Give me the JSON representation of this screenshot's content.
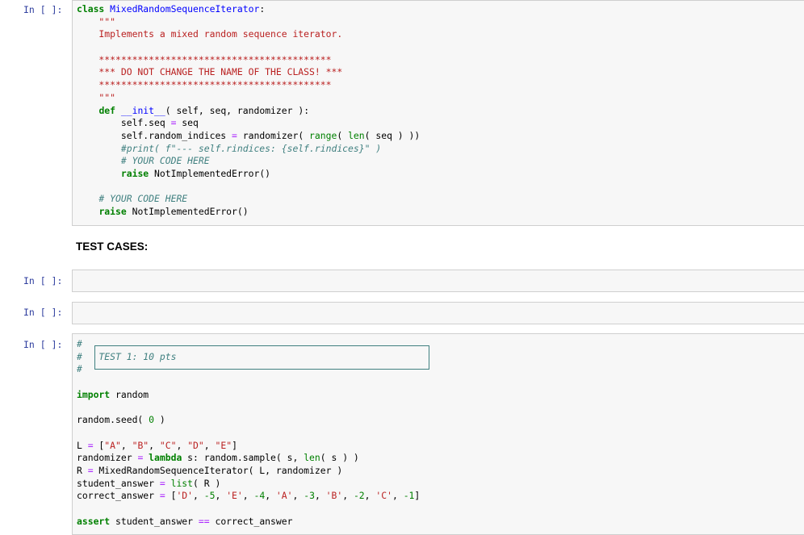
{
  "cells": {
    "cell1": {
      "prompt": "In [ ]:",
      "lines": [
        [
          {
            "t": "class ",
            "c": "kw"
          },
          {
            "t": "MixedRandomSequenceIterator",
            "c": "cls"
          },
          {
            "t": ":",
            "c": ""
          }
        ],
        [
          {
            "t": "    \"\"\"",
            "c": "str"
          }
        ],
        [
          {
            "t": "    Implements a mixed random sequence iterator.",
            "c": "str"
          }
        ],
        [
          {
            "t": "",
            "c": ""
          }
        ],
        [
          {
            "t": "    ******************************************",
            "c": "str"
          }
        ],
        [
          {
            "t": "    *** DO NOT CHANGE THE NAME OF THE CLASS! ***",
            "c": "str"
          }
        ],
        [
          {
            "t": "    ******************************************",
            "c": "str"
          }
        ],
        [
          {
            "t": "    \"\"\"",
            "c": "str"
          }
        ],
        [
          {
            "t": "    ",
            "c": ""
          },
          {
            "t": "def",
            "c": "kw"
          },
          {
            "t": " ",
            "c": ""
          },
          {
            "t": "__init__",
            "c": "cls"
          },
          {
            "t": "( self, seq, randomizer ):",
            "c": ""
          }
        ],
        [
          {
            "t": "        self",
            "c": ""
          },
          {
            "t": ".",
            "c": ""
          },
          {
            "t": "seq ",
            "c": ""
          },
          {
            "t": "=",
            "c": "op"
          },
          {
            "t": " seq",
            "c": ""
          }
        ],
        [
          {
            "t": "        self.random_indices ",
            "c": ""
          },
          {
            "t": "=",
            "c": "op"
          },
          {
            "t": " randomizer( ",
            "c": ""
          },
          {
            "t": "range",
            "c": "bi"
          },
          {
            "t": "( ",
            "c": ""
          },
          {
            "t": "len",
            "c": "bi"
          },
          {
            "t": "( seq ) ))",
            "c": ""
          }
        ],
        [
          {
            "t": "        #print( f\"--- self.rindices: {self.rindices}\" )",
            "c": "com"
          }
        ],
        [
          {
            "t": "        # YOUR CODE HERE",
            "c": "com"
          }
        ],
        [
          {
            "t": "        ",
            "c": ""
          },
          {
            "t": "raise",
            "c": "kw"
          },
          {
            "t": " NotImplementedError()",
            "c": ""
          }
        ],
        [
          {
            "t": "",
            "c": ""
          }
        ],
        [
          {
            "t": "    # YOUR CODE HERE",
            "c": "com"
          }
        ],
        [
          {
            "t": "    ",
            "c": ""
          },
          {
            "t": "raise",
            "c": "kw"
          },
          {
            "t": " NotImplementedError()",
            "c": ""
          }
        ]
      ]
    },
    "markdown": {
      "text": "TEST CASES:"
    },
    "cell2": {
      "prompt": "In [ ]:"
    },
    "cell3": {
      "prompt": "In [ ]:"
    },
    "cell4": {
      "prompt": "In [ ]:",
      "lines": [
        [
          {
            "t": "# ",
            "c": "com"
          }
        ],
        [
          {
            "t": "# ",
            "c": "com"
          },
          {
            "t": "  TEST 1: 10 pts",
            "c": "com"
          }
        ],
        [
          {
            "t": "# ",
            "c": "com"
          }
        ],
        [
          {
            "t": "",
            "c": ""
          }
        ],
        [
          {
            "t": "import",
            "c": "kw"
          },
          {
            "t": " random",
            "c": ""
          }
        ],
        [
          {
            "t": "",
            "c": ""
          }
        ],
        [
          {
            "t": "random.seed( ",
            "c": ""
          },
          {
            "t": "0",
            "c": "num"
          },
          {
            "t": " )",
            "c": ""
          }
        ],
        [
          {
            "t": "",
            "c": ""
          }
        ],
        [
          {
            "t": "L ",
            "c": ""
          },
          {
            "t": "=",
            "c": "op"
          },
          {
            "t": " [",
            "c": ""
          },
          {
            "t": "\"A\"",
            "c": "str"
          },
          {
            "t": ", ",
            "c": ""
          },
          {
            "t": "\"B\"",
            "c": "str"
          },
          {
            "t": ", ",
            "c": ""
          },
          {
            "t": "\"C\"",
            "c": "str"
          },
          {
            "t": ", ",
            "c": ""
          },
          {
            "t": "\"D\"",
            "c": "str"
          },
          {
            "t": ", ",
            "c": ""
          },
          {
            "t": "\"E\"",
            "c": "str"
          },
          {
            "t": "]",
            "c": ""
          }
        ],
        [
          {
            "t": "randomizer ",
            "c": ""
          },
          {
            "t": "=",
            "c": "op"
          },
          {
            "t": " ",
            "c": ""
          },
          {
            "t": "lambda",
            "c": "kw"
          },
          {
            "t": " s: random.sample( s, ",
            "c": ""
          },
          {
            "t": "len",
            "c": "bi"
          },
          {
            "t": "( s ) )",
            "c": ""
          }
        ],
        [
          {
            "t": "R ",
            "c": ""
          },
          {
            "t": "=",
            "c": "op"
          },
          {
            "t": " MixedRandomSequenceIterator( L, randomizer )",
            "c": ""
          }
        ],
        [
          {
            "t": "student_answer ",
            "c": ""
          },
          {
            "t": "=",
            "c": "op"
          },
          {
            "t": " ",
            "c": ""
          },
          {
            "t": "list",
            "c": "bi"
          },
          {
            "t": "( R )",
            "c": ""
          }
        ],
        [
          {
            "t": "correct_answer ",
            "c": ""
          },
          {
            "t": "=",
            "c": "op"
          },
          {
            "t": " [",
            "c": ""
          },
          {
            "t": "'D'",
            "c": "str"
          },
          {
            "t": ", ",
            "c": ""
          },
          {
            "t": "-5",
            "c": "num"
          },
          {
            "t": ", ",
            "c": ""
          },
          {
            "t": "'E'",
            "c": "str"
          },
          {
            "t": ", ",
            "c": ""
          },
          {
            "t": "-4",
            "c": "num"
          },
          {
            "t": ", ",
            "c": ""
          },
          {
            "t": "'A'",
            "c": "str"
          },
          {
            "t": ", ",
            "c": ""
          },
          {
            "t": "-3",
            "c": "num"
          },
          {
            "t": ", ",
            "c": ""
          },
          {
            "t": "'B'",
            "c": "str"
          },
          {
            "t": ", ",
            "c": ""
          },
          {
            "t": "-2",
            "c": "num"
          },
          {
            "t": ", ",
            "c": ""
          },
          {
            "t": "'C'",
            "c": "str"
          },
          {
            "t": ", ",
            "c": ""
          },
          {
            "t": "-1",
            "c": "num"
          },
          {
            "t": "]",
            "c": ""
          }
        ],
        [
          {
            "t": "",
            "c": ""
          }
        ],
        [
          {
            "t": "assert",
            "c": "kw"
          },
          {
            "t": " student_answer ",
            "c": ""
          },
          {
            "t": "==",
            "c": "op"
          },
          {
            "t": " correct_answer",
            "c": ""
          }
        ]
      ]
    }
  },
  "colors": {
    "prompt": "#303f9f",
    "keyword": "#008000",
    "string": "#ba2121",
    "comment": "#408080",
    "cell_bg": "#f7f7f7",
    "cell_border": "#cfcfcf"
  }
}
